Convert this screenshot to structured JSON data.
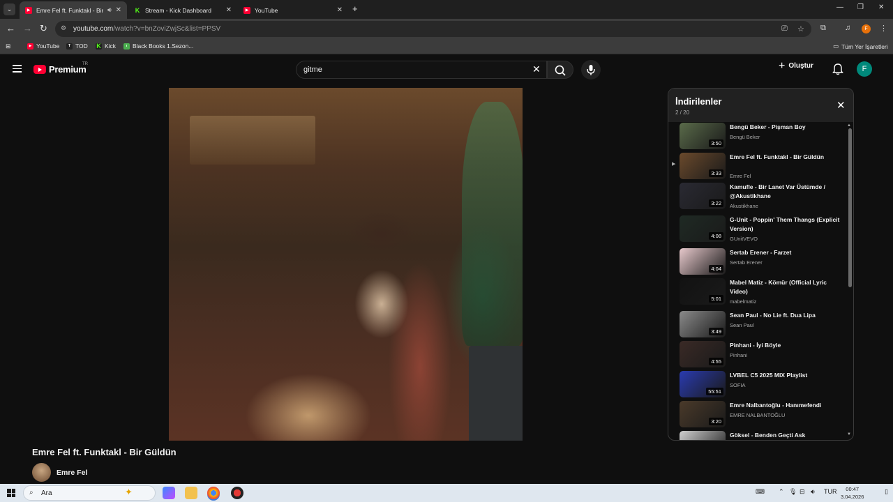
{
  "browser": {
    "tabs": [
      {
        "title": "Emre Fel ft. Funktakl - Bir G",
        "favicon": "youtube-icon",
        "active": true,
        "audio": true
      },
      {
        "title": "Stream - Kick Dashboard",
        "favicon": "kick-icon",
        "active": false
      },
      {
        "title": "YouTube",
        "favicon": "youtube-icon",
        "active": false
      }
    ],
    "url_host": "youtube.com",
    "url_path": "/watch?v=bnZoviZwjSc&list=PPSV",
    "bookmarks": [
      {
        "label": "YouTube",
        "icon": "youtube-icon"
      },
      {
        "label": "TOD",
        "icon": "tod-icon"
      },
      {
        "label": "Kick",
        "icon": "kick-icon"
      },
      {
        "label": "Black Books 1.Sezon...",
        "icon": "bookmark-icon"
      }
    ],
    "bookmarks_folder": "Tüm Yer İşaretleri",
    "profile_initial": "F"
  },
  "youtube": {
    "logo_text": "Premium",
    "country_code": "TR",
    "search_value": "gitme",
    "create_label": "Oluştur",
    "avatar_initial": "F",
    "video": {
      "title": "Emre Fel ft. Funktakl - Bir Güldün",
      "channel": "Emre Fel"
    },
    "playlist": {
      "title": "İndirilenler",
      "position": "2 / 20",
      "items": [
        {
          "title": "Bengü Beker - Pişman Boy",
          "channel": "Bengü Beker",
          "duration": "3:50",
          "thumb": "#5a6b4a"
        },
        {
          "title": "Emre Fel ft. Funktakl - Bir Güldün",
          "channel": "Emre Fel",
          "duration": "3:33",
          "thumb": "#6b4a2c",
          "playing": true
        },
        {
          "title": "Kamufle - Bir Lanet Var Üstümde / @Akustikhane",
          "channel": "Akustikhane",
          "duration": "3:22",
          "thumb": "#2a2a33"
        },
        {
          "title": "G-Unit - Poppin' Them Thangs (Explicit Version)",
          "channel": "GUnitVEVO",
          "duration": "4:08",
          "thumb": "#1f2a24"
        },
        {
          "title": "Sertab Erener - Farzet",
          "channel": "Sertab Erener",
          "duration": "4:04",
          "thumb": "#e8c9cc"
        },
        {
          "title": "Mabel Matiz - Kömür (Official Lyric Video)",
          "channel": "mabelmatiz",
          "duration": "5:01",
          "thumb": "#121212"
        },
        {
          "title": "Sean Paul - No Lie ft. Dua Lipa",
          "channel": "Sean Paul",
          "duration": "3:49",
          "thumb": "#8a8a8a"
        },
        {
          "title": "Pinhani - İyi Böyle",
          "channel": "Pinhani",
          "duration": "4:55",
          "thumb": "#3a2a26"
        },
        {
          "title": "LVBEL C5 2025 MIX Playlist",
          "channel": "SOFIA",
          "duration": "55:51",
          "thumb": "#2a3bb0"
        },
        {
          "title": "Emre Nalbantoğlu - Hanımefendi",
          "channel": "EMRE NALBANTOĞLU",
          "duration": "3:20",
          "thumb": "#4a3a2a"
        },
        {
          "title": "Göksel - Benden Geçti Ask",
          "channel": "",
          "duration": "",
          "thumb": "#cfcfcf"
        }
      ]
    }
  },
  "taskbar": {
    "search_label": "Ara",
    "language": "TUR",
    "time": "00:47",
    "date": "3.04.2026"
  }
}
